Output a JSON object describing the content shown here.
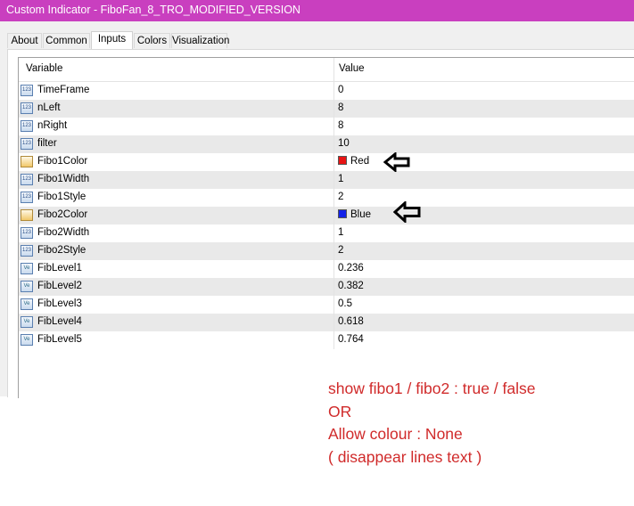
{
  "window": {
    "title": "Custom Indicator - FiboFan_8_TRO_MODIFIED_VERSION"
  },
  "tabs": [
    {
      "label": "About",
      "active": false
    },
    {
      "label": "Common",
      "active": false
    },
    {
      "label": "Inputs",
      "active": true
    },
    {
      "label": "Colors",
      "active": false
    },
    {
      "label": "Visualization",
      "active": false
    }
  ],
  "grid": {
    "headers": {
      "variable": "Variable",
      "value": "Value"
    },
    "rows": [
      {
        "icon": "int-icon",
        "name": "TimeFrame",
        "value": "0"
      },
      {
        "icon": "int-icon",
        "name": "nLeft",
        "value": "8"
      },
      {
        "icon": "int-icon",
        "name": "nRight",
        "value": "8"
      },
      {
        "icon": "int-icon",
        "name": "filter",
        "value": "10"
      },
      {
        "icon": "color-icon",
        "name": "Fibo1Color",
        "value": "Red",
        "swatch": "#e81313"
      },
      {
        "icon": "int-icon",
        "name": "Fibo1Width",
        "value": "1"
      },
      {
        "icon": "int-icon",
        "name": "Fibo1Style",
        "value": "2"
      },
      {
        "icon": "color-icon",
        "name": "Fibo2Color",
        "value": "Blue",
        "swatch": "#1322e8"
      },
      {
        "icon": "int-icon",
        "name": "Fibo2Width",
        "value": "1"
      },
      {
        "icon": "int-icon",
        "name": "Fibo2Style",
        "value": "2"
      },
      {
        "icon": "double-icon",
        "name": "FibLevel1",
        "value": "0.236"
      },
      {
        "icon": "double-icon",
        "name": "FibLevel2",
        "value": "0.382"
      },
      {
        "icon": "double-icon",
        "name": "FibLevel3",
        "value": "0.5"
      },
      {
        "icon": "double-icon",
        "name": "FibLevel4",
        "value": "0.618"
      },
      {
        "icon": "double-icon",
        "name": "FibLevel5",
        "value": "0.764"
      }
    ]
  },
  "note": {
    "lines": [
      "show fibo1 / fibo2 : true / false",
      "OR",
      "Allow colour : None",
      "( disappear lines text )"
    ],
    "color": "#d02a2a"
  },
  "colors": {
    "titlebar": "#c93fbf"
  }
}
